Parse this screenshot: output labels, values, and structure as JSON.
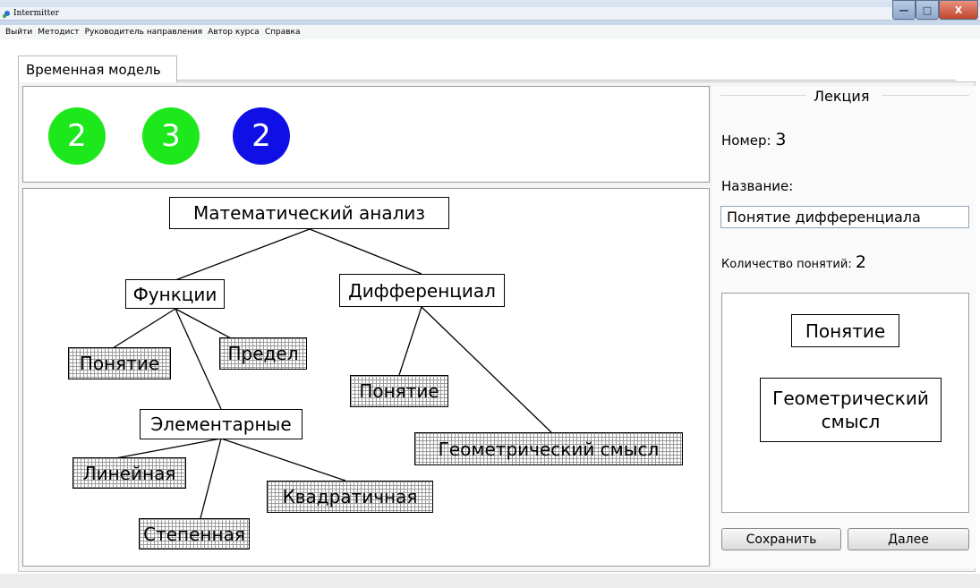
{
  "window": {
    "title": "Intermitter",
    "minimize_glyph": "—",
    "maximize_glyph": "□",
    "close_glyph": "X"
  },
  "menu": [
    "Выйти",
    "Методист",
    "Руководитель направления",
    "Автор курса",
    "Справка"
  ],
  "tab": {
    "label": "Временная модель"
  },
  "lecture_circles": [
    {
      "value": "2",
      "color": "#1ce81c"
    },
    {
      "value": "3",
      "color": "#1ce81c"
    },
    {
      "value": "2",
      "color": "#1010e6"
    }
  ],
  "tree": {
    "root": "Математический анализ",
    "functions": "Функции",
    "differential": "Дифференциал",
    "f_concept": "Понятие",
    "f_limit": "Предел",
    "elementary": "Элементарные",
    "linear": "Линейная",
    "power": "Степенная",
    "quadratic": "Квадратичная",
    "d_concept": "Понятие",
    "d_geometric": "Геометрический смысл"
  },
  "lecture": {
    "group_title": "Лекция",
    "number_label": "Номер:",
    "number_value": "3",
    "name_label": "Название:",
    "name_value": "Понятие дифференциала",
    "count_label": "Количество понятий:",
    "count_value": "2",
    "concept_1": "Понятие",
    "concept_2_line1": "Геометрический",
    "concept_2_line2": "смысл",
    "save_button": "Сохранить",
    "next_button": "Далее"
  }
}
